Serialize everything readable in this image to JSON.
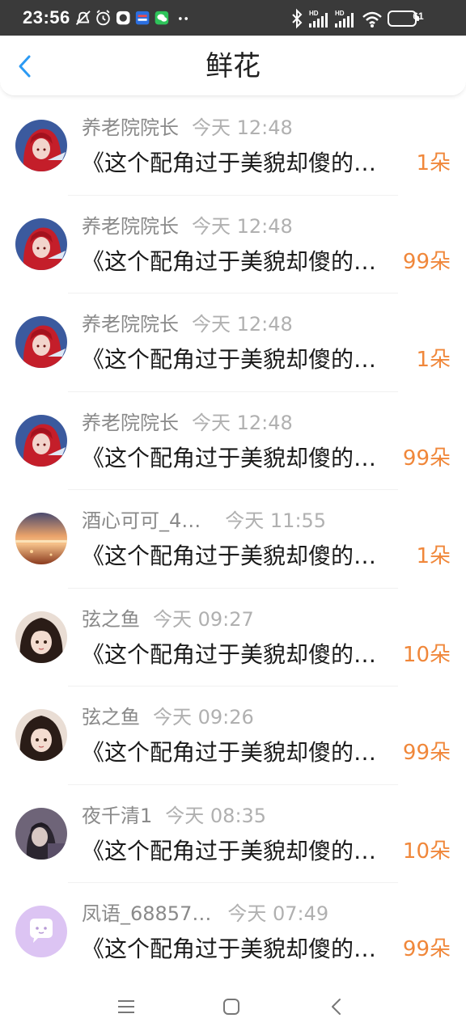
{
  "status_bar": {
    "time": "23:56",
    "battery": "61",
    "icons": [
      "mute-bell-icon",
      "alarm-icon",
      "app-icon",
      "app-icon",
      "wechat-icon",
      "more-icon",
      "bluetooth-icon",
      "signal-hd-icon",
      "signal-hd-icon",
      "wifi-icon",
      "battery-icon"
    ]
  },
  "header": {
    "title": "鲜花",
    "back_icon": "chevron-left-icon"
  },
  "colors": {
    "accent_blue": "#2b9af3",
    "count_orange": "#f0873a",
    "status_bar_bg": "#3a3a3a"
  },
  "items": [
    {
      "name": "养老院院长",
      "time": "今天 12:48",
      "message": "《这个配角过于美貌却傻的…",
      "count": "1朵",
      "avatar": "red-hair-anime-avatar"
    },
    {
      "name": "养老院院长",
      "time": "今天 12:48",
      "message": "《这个配角过于美貌却傻的…",
      "count": "99朵",
      "avatar": "red-hair-anime-avatar"
    },
    {
      "name": "养老院院长",
      "time": "今天 12:48",
      "message": "《这个配角过于美貌却傻的…",
      "count": "1朵",
      "avatar": "red-hair-anime-avatar"
    },
    {
      "name": "养老院院长",
      "time": "今天 12:48",
      "message": "《这个配角过于美貌却傻的…",
      "count": "99朵",
      "avatar": "red-hair-anime-avatar"
    },
    {
      "name": "酒心可可_4…",
      "time": "今天 11:55",
      "message": "《这个配角过于美貌却傻的…",
      "count": "1朵",
      "avatar": "sunset-avatar"
    },
    {
      "name": "弦之鱼",
      "time": "今天 09:27",
      "message": "《这个配角过于美貌却傻的…",
      "count": "10朵",
      "avatar": "anime-girl-avatar"
    },
    {
      "name": "弦之鱼",
      "time": "今天 09:26",
      "message": "《这个配角过于美貌却傻的…",
      "count": "99朵",
      "avatar": "anime-girl-avatar"
    },
    {
      "name": "夜千清1",
      "time": "今天 08:35",
      "message": "《这个配角过于美貌却傻的…",
      "count": "10朵",
      "avatar": "dark-portrait-avatar"
    },
    {
      "name": "凤语_68857…",
      "time": "今天 07:49",
      "message": "《这个配角过于美貌却傻的…",
      "count": "99朵",
      "avatar": "default-chat-avatar"
    }
  ],
  "nav_bar": {
    "buttons": [
      "menu-icon",
      "home-icon",
      "back-icon"
    ]
  }
}
